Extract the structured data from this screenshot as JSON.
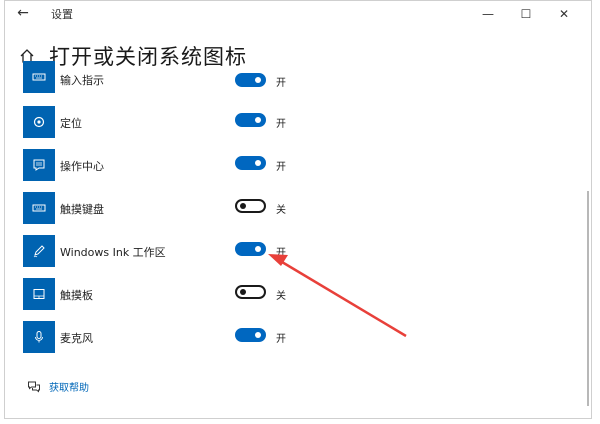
{
  "window": {
    "title": "设置",
    "back_glyph": "←",
    "minimize_glyph": "—",
    "maximize_glyph": "☐",
    "close_glyph": "✕"
  },
  "page": {
    "title": "打开或关闭系统图标"
  },
  "items": [
    {
      "label": "输入指示",
      "state": "开",
      "on": true,
      "icon": "keyboard-icon"
    },
    {
      "label": "定位",
      "state": "开",
      "on": true,
      "icon": "location-icon"
    },
    {
      "label": "操作中心",
      "state": "开",
      "on": true,
      "icon": "action-center-icon"
    },
    {
      "label": "触摸键盘",
      "state": "关",
      "on": false,
      "icon": "touch-keyboard-icon"
    },
    {
      "label": "Windows Ink 工作区",
      "state": "开",
      "on": true,
      "icon": "pen-icon"
    },
    {
      "label": "触摸板",
      "state": "关",
      "on": false,
      "icon": "touchpad-icon"
    },
    {
      "label": "麦克风",
      "state": "开",
      "on": true,
      "icon": "microphone-icon"
    }
  ],
  "help": {
    "label": "获取帮助"
  },
  "colors": {
    "accent": "#0067c0",
    "tile": "#0063b1",
    "annotation_arrow": "#e8403a"
  }
}
